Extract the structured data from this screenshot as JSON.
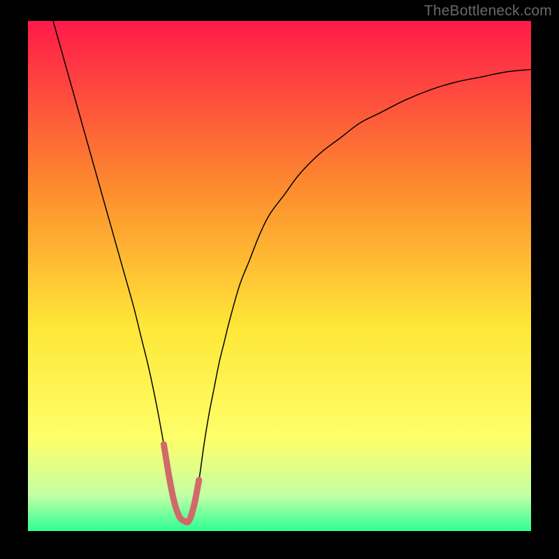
{
  "watermark": "TheBottleneck.com",
  "chart_data": {
    "type": "line",
    "title": "",
    "xlabel": "",
    "ylabel": "",
    "xlim": [
      0,
      100
    ],
    "ylim": [
      0,
      100
    ],
    "grid": false,
    "legend": false,
    "background_gradient": {
      "top": "#fe1a4a",
      "upper_mid": "#fd8c2e",
      "mid": "#fee738",
      "lower_mid": "#feff6a",
      "near_bottom": "#c3ffa5",
      "bottom": "#2eff94"
    },
    "series": [
      {
        "name": "bottleneck-curve",
        "color": "#000000",
        "width": 1.5,
        "x": [
          5,
          7,
          9,
          11,
          13,
          15,
          17,
          19,
          21,
          22.5,
          24,
          25.5,
          27,
          28,
          29,
          30,
          31,
          32,
          33,
          34,
          35,
          36,
          37,
          38,
          39,
          40,
          42,
          44,
          46,
          48,
          51,
          54,
          58,
          62,
          66,
          70,
          75,
          80,
          85,
          90,
          95,
          100
        ],
        "y": [
          100,
          93,
          86,
          79,
          72,
          65,
          58,
          51,
          44,
          38,
          32,
          25,
          17,
          11,
          6,
          3,
          2,
          2,
          5,
          10,
          17,
          23,
          28,
          33,
          37,
          41,
          48,
          53,
          58,
          62,
          66,
          70,
          74,
          77,
          80,
          82,
          84.5,
          86.5,
          88,
          89,
          90,
          90.5
        ]
      },
      {
        "name": "valley-highlight",
        "color": "#d06a6a",
        "width": 9,
        "linecap": "round",
        "x": [
          27,
          28,
          29,
          30,
          31,
          32,
          33,
          34
        ],
        "y": [
          17,
          11,
          6,
          3,
          2,
          2,
          5,
          10
        ]
      }
    ]
  }
}
